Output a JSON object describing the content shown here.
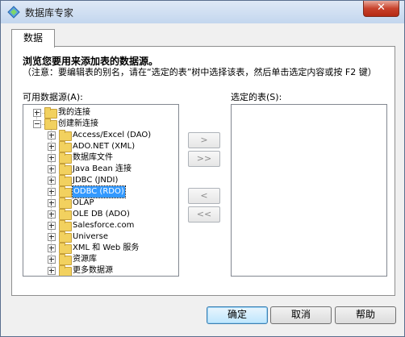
{
  "window": {
    "title": "数据库专家",
    "close_label": "✕",
    "app_icon": "database-expert-icon"
  },
  "tabs": [
    {
      "label": "数据"
    }
  ],
  "content": {
    "heading": "浏览您要用来添加表的数据源。",
    "note": "（注意：要编辑表的别名，请在“选定的表”树中选择该表，然后单击选定内容或按 F2 键）",
    "available_label": "可用数据源(A):",
    "selected_label": "选定的表(S):"
  },
  "tree": {
    "nodes": [
      {
        "label": "我的连接",
        "expanded": false
      },
      {
        "label": "创建新连接",
        "expanded": true
      },
      {
        "label": "Access/Excel (DAO)"
      },
      {
        "label": "ADO.NET (XML)"
      },
      {
        "label": "数据库文件"
      },
      {
        "label": "Java Bean 连接"
      },
      {
        "label": "JDBC (JNDI)"
      },
      {
        "label": "ODBC (RDO)",
        "selected": true
      },
      {
        "label": "OLAP"
      },
      {
        "label": "OLE DB (ADO)"
      },
      {
        "label": "Salesforce.com"
      },
      {
        "label": "Universe"
      },
      {
        "label": "XML 和 Web 服务"
      },
      {
        "label": "资源库"
      },
      {
        "label": "更多数据源"
      }
    ]
  },
  "transfer_buttons": {
    "add": ">",
    "add_all": ">>",
    "remove": "<",
    "remove_all": "<<"
  },
  "footer": {
    "ok": "确定",
    "cancel": "取消",
    "help": "帮助"
  }
}
